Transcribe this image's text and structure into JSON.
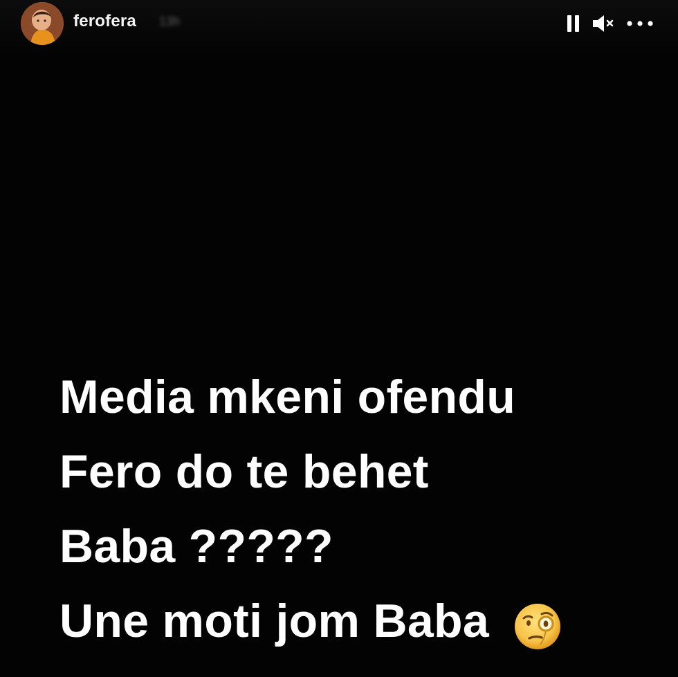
{
  "story": {
    "username": "ferofera",
    "timestamp": "13h",
    "controls": {
      "pause_icon": "pause-icon",
      "mute_icon": "volume-muted-icon",
      "more_icon": "more-options-icon"
    },
    "message_lines": [
      "Media mkeni ofendu",
      "Fero do te behet",
      "Baba ?????",
      "Une moti jom Baba"
    ],
    "emoji": "face-with-monocle-emoji"
  },
  "colors": {
    "background": "#030303",
    "text": "#ffffff",
    "emoji_face": "#f7c44a"
  }
}
